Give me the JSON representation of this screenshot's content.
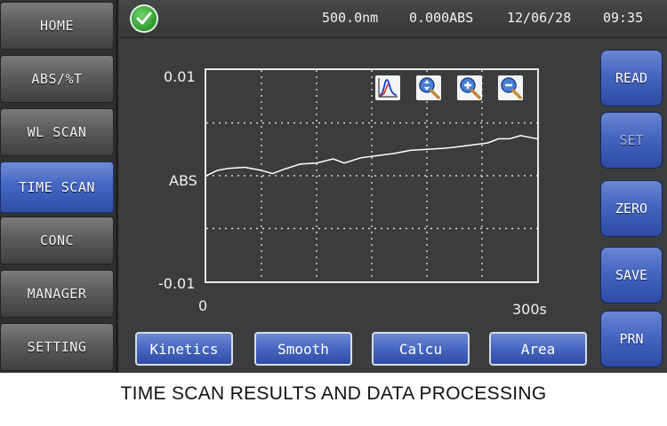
{
  "sidebar": {
    "items": [
      {
        "label": "HOME",
        "active": false
      },
      {
        "label": "ABS/%T",
        "active": false
      },
      {
        "label": "WL SCAN",
        "active": false
      },
      {
        "label": "TIME SCAN",
        "active": true
      },
      {
        "label": "CONC",
        "active": false
      },
      {
        "label": "MANAGER",
        "active": false
      },
      {
        "label": "SETTING",
        "active": false
      }
    ]
  },
  "status": {
    "icon": "check-icon",
    "wavelength": "500.0nm",
    "absorbance": "0.000ABS",
    "date": "12/06/28",
    "time": "09:35"
  },
  "graph": {
    "y_top": "0.01",
    "y_mid": "ABS",
    "y_bottom": "-0.01",
    "x_start": "0",
    "x_end": "300s",
    "tools": [
      "curve-view-icon",
      "zoom-fit-icon",
      "zoom-in-icon",
      "zoom-out-icon"
    ]
  },
  "right_buttons": [
    {
      "label": "READ",
      "enabled": true
    },
    {
      "label": "SET",
      "enabled": false
    },
    {
      "label": "ZERO",
      "enabled": true
    },
    {
      "label": "SAVE",
      "enabled": true
    },
    {
      "label": "PRN",
      "enabled": true
    }
  ],
  "function_buttons": [
    "Kinetics",
    "Smooth",
    "Calcu",
    "Area"
  ],
  "caption": "TIME SCAN RESULTS AND DATA PROCESSING",
  "chart_data": {
    "type": "line",
    "xlabel": "",
    "ylabel": "ABS",
    "xlim": [
      0,
      300
    ],
    "ylim": [
      -0.01,
      0.01
    ],
    "grid": true,
    "series": [
      {
        "x": [
          0,
          10,
          20,
          35,
          50,
          60,
          70,
          85,
          100,
          115,
          125,
          140,
          155,
          170,
          185,
          200,
          215,
          225,
          240,
          255,
          265,
          275,
          285,
          295,
          300
        ],
        "y": [
          0.0,
          0.0005,
          0.0007,
          0.0008,
          0.0005,
          0.0002,
          0.0006,
          0.0011,
          0.0012,
          0.0016,
          0.0012,
          0.0017,
          0.0019,
          0.0021,
          0.0024,
          0.0025,
          0.0026,
          0.0027,
          0.0029,
          0.0031,
          0.0035,
          0.0035,
          0.0038,
          0.0036,
          0.0035
        ]
      }
    ]
  }
}
